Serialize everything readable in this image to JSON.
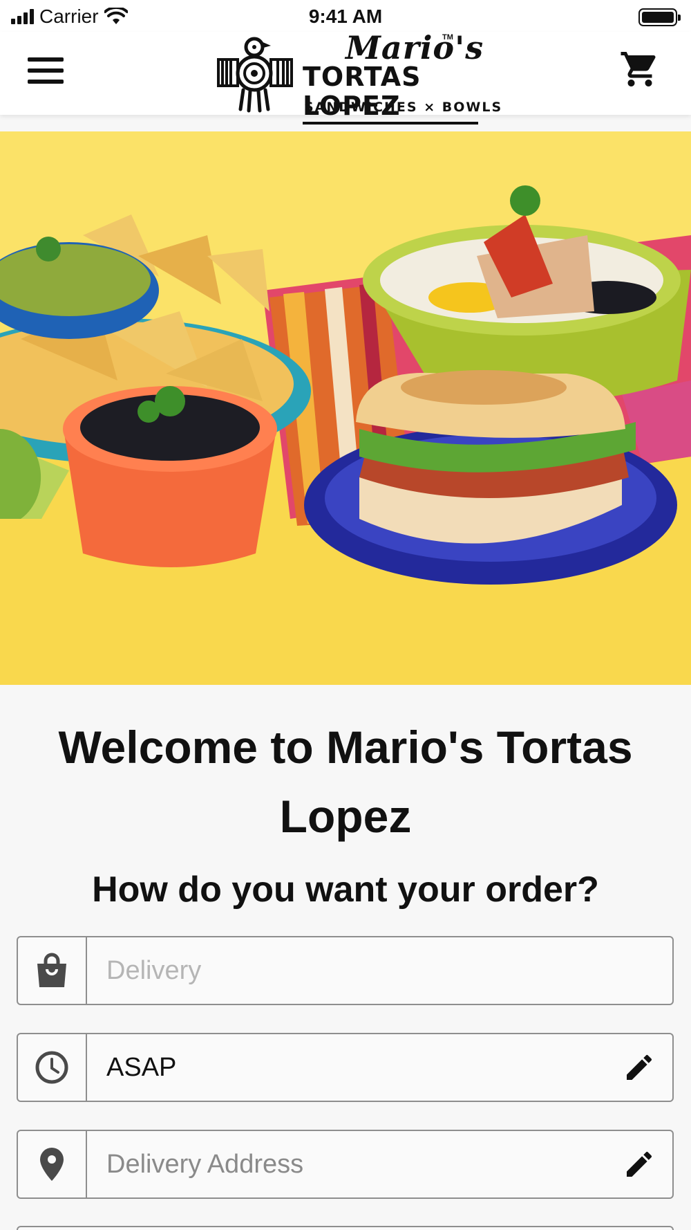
{
  "status_bar": {
    "carrier": "Carrier",
    "time": "9:41 AM"
  },
  "header": {
    "logo": {
      "script": "Mario's",
      "tm": "TM",
      "main": "TORTAS LOPEZ",
      "sub": "SANDWICHES × BOWLS"
    }
  },
  "content": {
    "welcome": "Welcome to Mario's Tortas Lopez",
    "question": "How do you want your order?"
  },
  "fields": {
    "order_type": {
      "placeholder": "Delivery",
      "icon": "shopping-bag-icon"
    },
    "time": {
      "value": "ASAP",
      "icon": "clock-icon"
    },
    "address": {
      "placeholder": "Delivery Address",
      "icon": "location-pin-icon"
    }
  },
  "colors": {
    "hero_background": "#f9d84d",
    "field_border": "#8e8e8e",
    "header_background": "#ffffff"
  }
}
